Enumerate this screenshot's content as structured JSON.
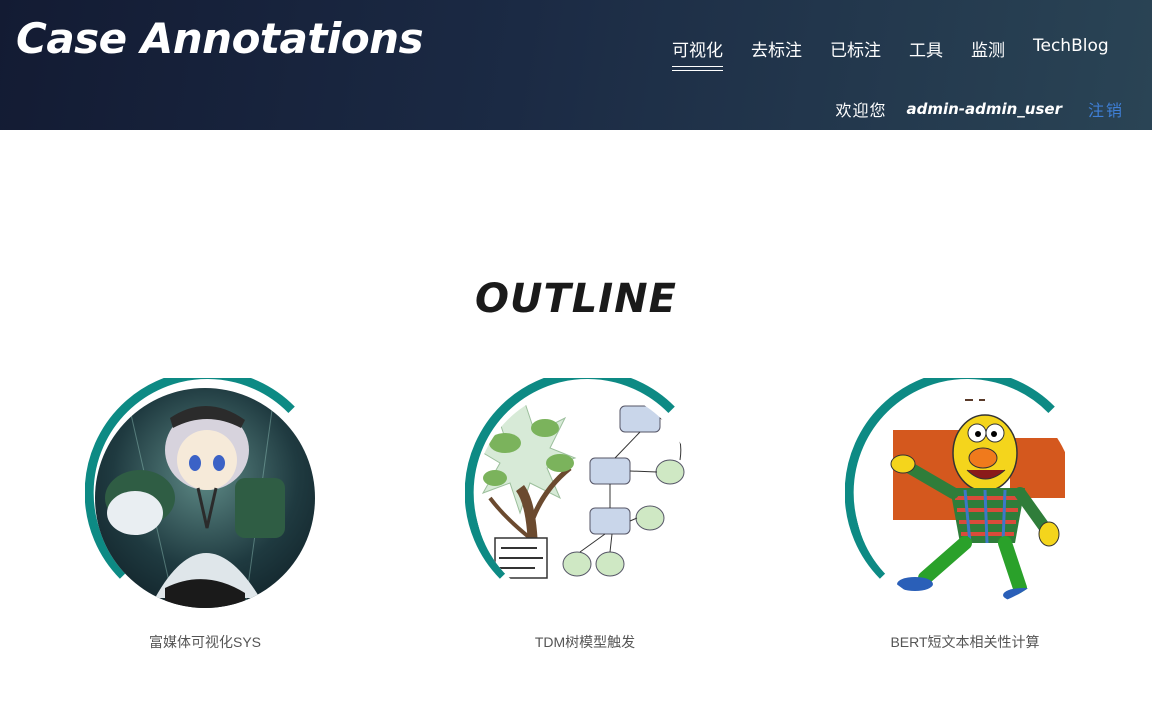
{
  "header": {
    "brand": "Case Annotations",
    "nav": [
      {
        "label": "可视化",
        "active": true
      },
      {
        "label": "去标注",
        "active": false
      },
      {
        "label": "已标注",
        "active": false
      },
      {
        "label": "工具",
        "active": false
      },
      {
        "label": "监测",
        "active": false
      },
      {
        "label": "TechBlog",
        "active": false
      }
    ],
    "welcome": "欢迎您",
    "username": "admin-admin_user",
    "logout": "注销"
  },
  "main": {
    "title": "OUTLINE",
    "cards": [
      {
        "caption": "富媒体可视化SYS",
        "image": "anime-character-thumbnail"
      },
      {
        "caption": "TDM树模型触发",
        "image": "decision-tree-diagram-thumbnail"
      },
      {
        "caption": "BERT短文本相关性计算",
        "image": "bert-character-thumbnail"
      }
    ]
  },
  "colors": {
    "header_start": "#131b33",
    "header_end": "#2a4455",
    "ring": "#0d8a84",
    "logout": "#3f7fd6",
    "title": "#1a1a1a"
  }
}
